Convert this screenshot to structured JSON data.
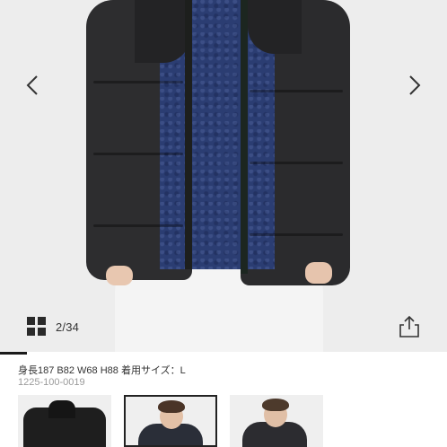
{
  "gallery": {
    "counter": "2/34",
    "current_index": 2,
    "total": 34,
    "progress_fraction": 0.06,
    "prev_icon": "chevron-left-icon",
    "next_icon": "chevron-right-icon",
    "grid_icon": "grid-view-icon",
    "share_icon": "share-icon"
  },
  "product": {
    "size_info": "身長187 B82 W68 H88 着用サイズ：L",
    "code": "1225-100-0019"
  },
  "thumbnails": [
    {
      "name": "thumbnail-1",
      "selected": false
    },
    {
      "name": "thumbnail-2",
      "selected": true
    },
    {
      "name": "thumbnail-3",
      "selected": false
    }
  ],
  "colors": {
    "jacket": "#2d2d2f",
    "sweater": "#2b3d72",
    "background": "#ededed",
    "selected_border": "#222222"
  }
}
